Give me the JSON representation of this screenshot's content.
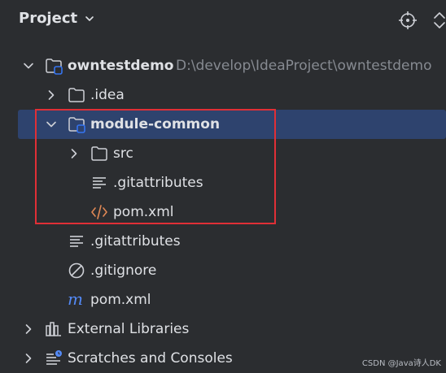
{
  "panel": {
    "title": "Project"
  },
  "tree": {
    "root": {
      "name": "owntestdemo",
      "path": "D:\\develop\\IdeaProject\\owntestdemo"
    },
    "idea": {
      "name": ".idea"
    },
    "module": {
      "name": "module-common"
    },
    "src": {
      "name": "src"
    },
    "module_gitattributes": {
      "name": ".gitattributes"
    },
    "module_pom": {
      "name": "pom.xml"
    },
    "root_gitattributes": {
      "name": ".gitattributes"
    },
    "gitignore": {
      "name": ".gitignore"
    },
    "root_pom": {
      "name": "pom.xml"
    },
    "external_libraries": {
      "name": "External Libraries"
    },
    "scratches": {
      "name": "Scratches and Consoles"
    }
  },
  "watermark": "CSDN @Java诗人DK",
  "colors": {
    "background": "#2b2d30",
    "selection": "#2e436e",
    "highlight_border": "#e02f36",
    "folder_icon": "#ced0d6",
    "module_badge": "#3574f0",
    "xml_icon": "#e08855",
    "maven_icon": "#548af7"
  }
}
